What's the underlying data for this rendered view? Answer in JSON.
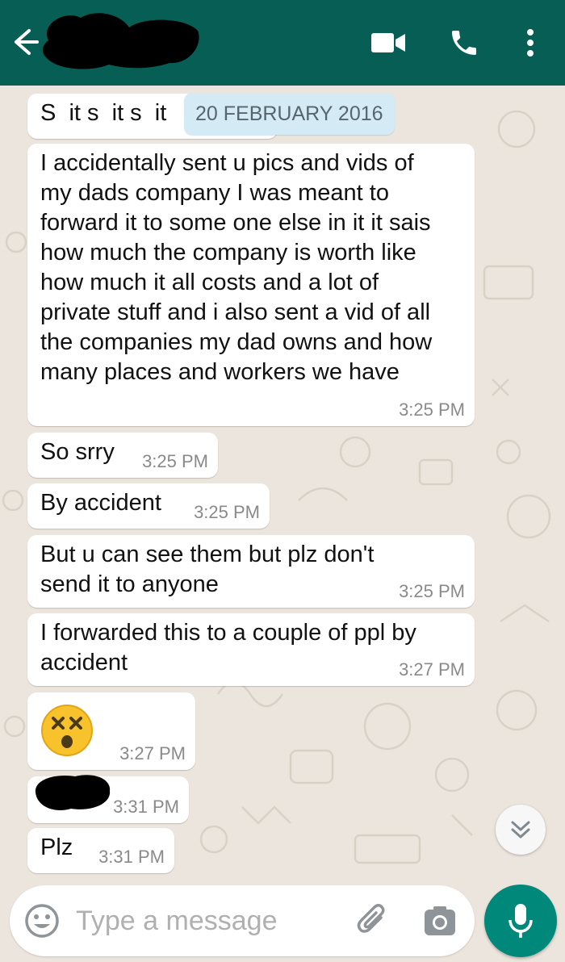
{
  "header": {
    "contact_name": "",
    "icons": [
      "back-arrow-icon",
      "video-call-icon",
      "phone-icon",
      "more-vert-icon"
    ],
    "color": "#075E54"
  },
  "date_chip": "20 FEBRUARY 2016",
  "messages": [
    {
      "text": "S  it s  it s  it",
      "time": ""
    },
    {
      "text": "I accidentally sent u pics and vids of my dads company I was meant to forward it to some one else in it it sais how much the company is worth like how much it all costs and a lot of private stuff and i also sent a vid of all the companies my dad owns and how many places and workers we have",
      "time": "3:25 PM"
    },
    {
      "text": "So srry",
      "time": "3:25 PM"
    },
    {
      "text": "By accident",
      "time": "3:25 PM"
    },
    {
      "text": "But u can see them but plz don't send it to anyone",
      "time": "3:25 PM"
    },
    {
      "text": "I forwarded this to a couple of ppl by accident",
      "time": "3:27 PM"
    },
    {
      "text": "",
      "emoji": "dizzy-face-emoji",
      "time": "3:27 PM"
    },
    {
      "text": "",
      "redacted": true,
      "time": "3:31 PM"
    },
    {
      "text": "Plz",
      "time": "3:31 PM"
    }
  ],
  "input": {
    "placeholder": "Type a message",
    "icons": [
      "emoji-icon",
      "attach-icon",
      "camera-icon"
    ]
  },
  "fab": {
    "icon": "mic-icon",
    "color": "#00897B"
  },
  "scroll_button_icon": "double-chevron-down-icon"
}
